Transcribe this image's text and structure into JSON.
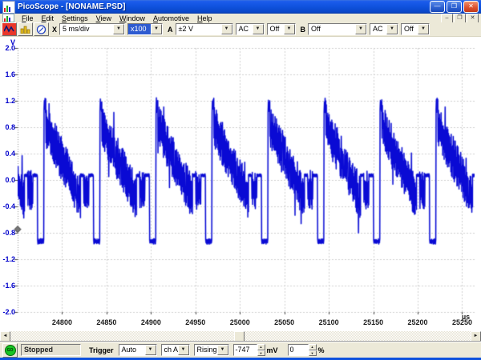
{
  "window": {
    "title": "PicoScope - [NONAME.PSD]"
  },
  "icons": {
    "dropdown": "▼",
    "minimize": "—",
    "restore": "❐",
    "close": "✕",
    "mdi_minimize": "–",
    "mdi_restore": "❐",
    "mdi_close": "✕",
    "scroll_left": "◄",
    "scroll_right": "►",
    "spin_up": "▲",
    "spin_down": "▼"
  },
  "menu": {
    "items": [
      "File",
      "Edit",
      "Settings",
      "View",
      "Window",
      "Automotive",
      "Help"
    ]
  },
  "toolbar": {
    "view_buttons": [
      "scope-view",
      "spectrum-view",
      "meter-view"
    ],
    "x_label": "X",
    "timebase": "5 ms/div",
    "zoom": "x100",
    "a_label": "A",
    "a_range": "±2 V",
    "a_coupling": "AC",
    "a_extra": "Off",
    "b_label": "B",
    "b_range": "Off",
    "b_coupling": "AC",
    "b_extra": "Off"
  },
  "status": {
    "go": "GO",
    "state": "Stopped",
    "trigger_label": "Trigger",
    "mode": "Auto",
    "channel": "ch A",
    "edge": "Rising",
    "threshold": "-747",
    "threshold_unit": "mV",
    "delay": "0",
    "delay_unit": "%"
  },
  "chart_data": {
    "type": "line",
    "title": "",
    "xlabel": "µs",
    "ylabel": "V",
    "xlim": [
      24750,
      25264
    ],
    "ylim": [
      -2.0,
      2.0
    ],
    "x_ticks": [
      "24800",
      "24850",
      "24900",
      "24950",
      "25000",
      "25050",
      "25100",
      "25150",
      "25200",
      "25250"
    ],
    "y_ticks": [
      "2.0",
      "1.6",
      "1.2",
      "0.8",
      "0.4",
      "0.0",
      "-0.4",
      "-0.8",
      "-1.2",
      "-1.6",
      "-2.0"
    ],
    "grid": "dashed",
    "grid_color": "#cfcfcf",
    "trace_color": "#0a0ad4",
    "trace_halo_color": "#9aa0ee",
    "axis_label_color_y": "#0000cc",
    "axis_label_color_x": "#1c1c1c",
    "trigger_level_v": -0.747,
    "waveform": {
      "description": "repetitive pulse train: sharp rise to ~1.2 V, wide noisy band ramping down to ~-0.3 V, quiet 0.07 V shelf, short noisy dip burst, clean low pulse at ~-0.93 V, then next rising edge",
      "first_edge_us": 24716.7,
      "period_us": 63.0,
      "cycles": 9,
      "noise_seed": 7,
      "segments": [
        {
          "name": "top",
          "start": 0,
          "end": 2.2,
          "center": 1.13,
          "noise": 0.12
        },
        {
          "name": "ramp-band",
          "start": 2.2,
          "end": 41.0,
          "center_start": 0.82,
          "center_end": -0.28,
          "noise": 0.33
        },
        {
          "name": "flat",
          "start": 41.0,
          "end": 44.5,
          "center": 0.07,
          "noise": 0.025
        },
        {
          "name": "dip-burst",
          "start": 44.5,
          "end": 50.5,
          "center": -0.15,
          "noise": 0.3
        },
        {
          "name": "flat2",
          "start": 50.5,
          "end": 55.8,
          "center": 0.07,
          "noise": 0.025
        },
        {
          "name": "low-pulse",
          "start": 55.8,
          "end": 63.0,
          "center": -0.93,
          "noise": 0.04
        }
      ]
    }
  }
}
